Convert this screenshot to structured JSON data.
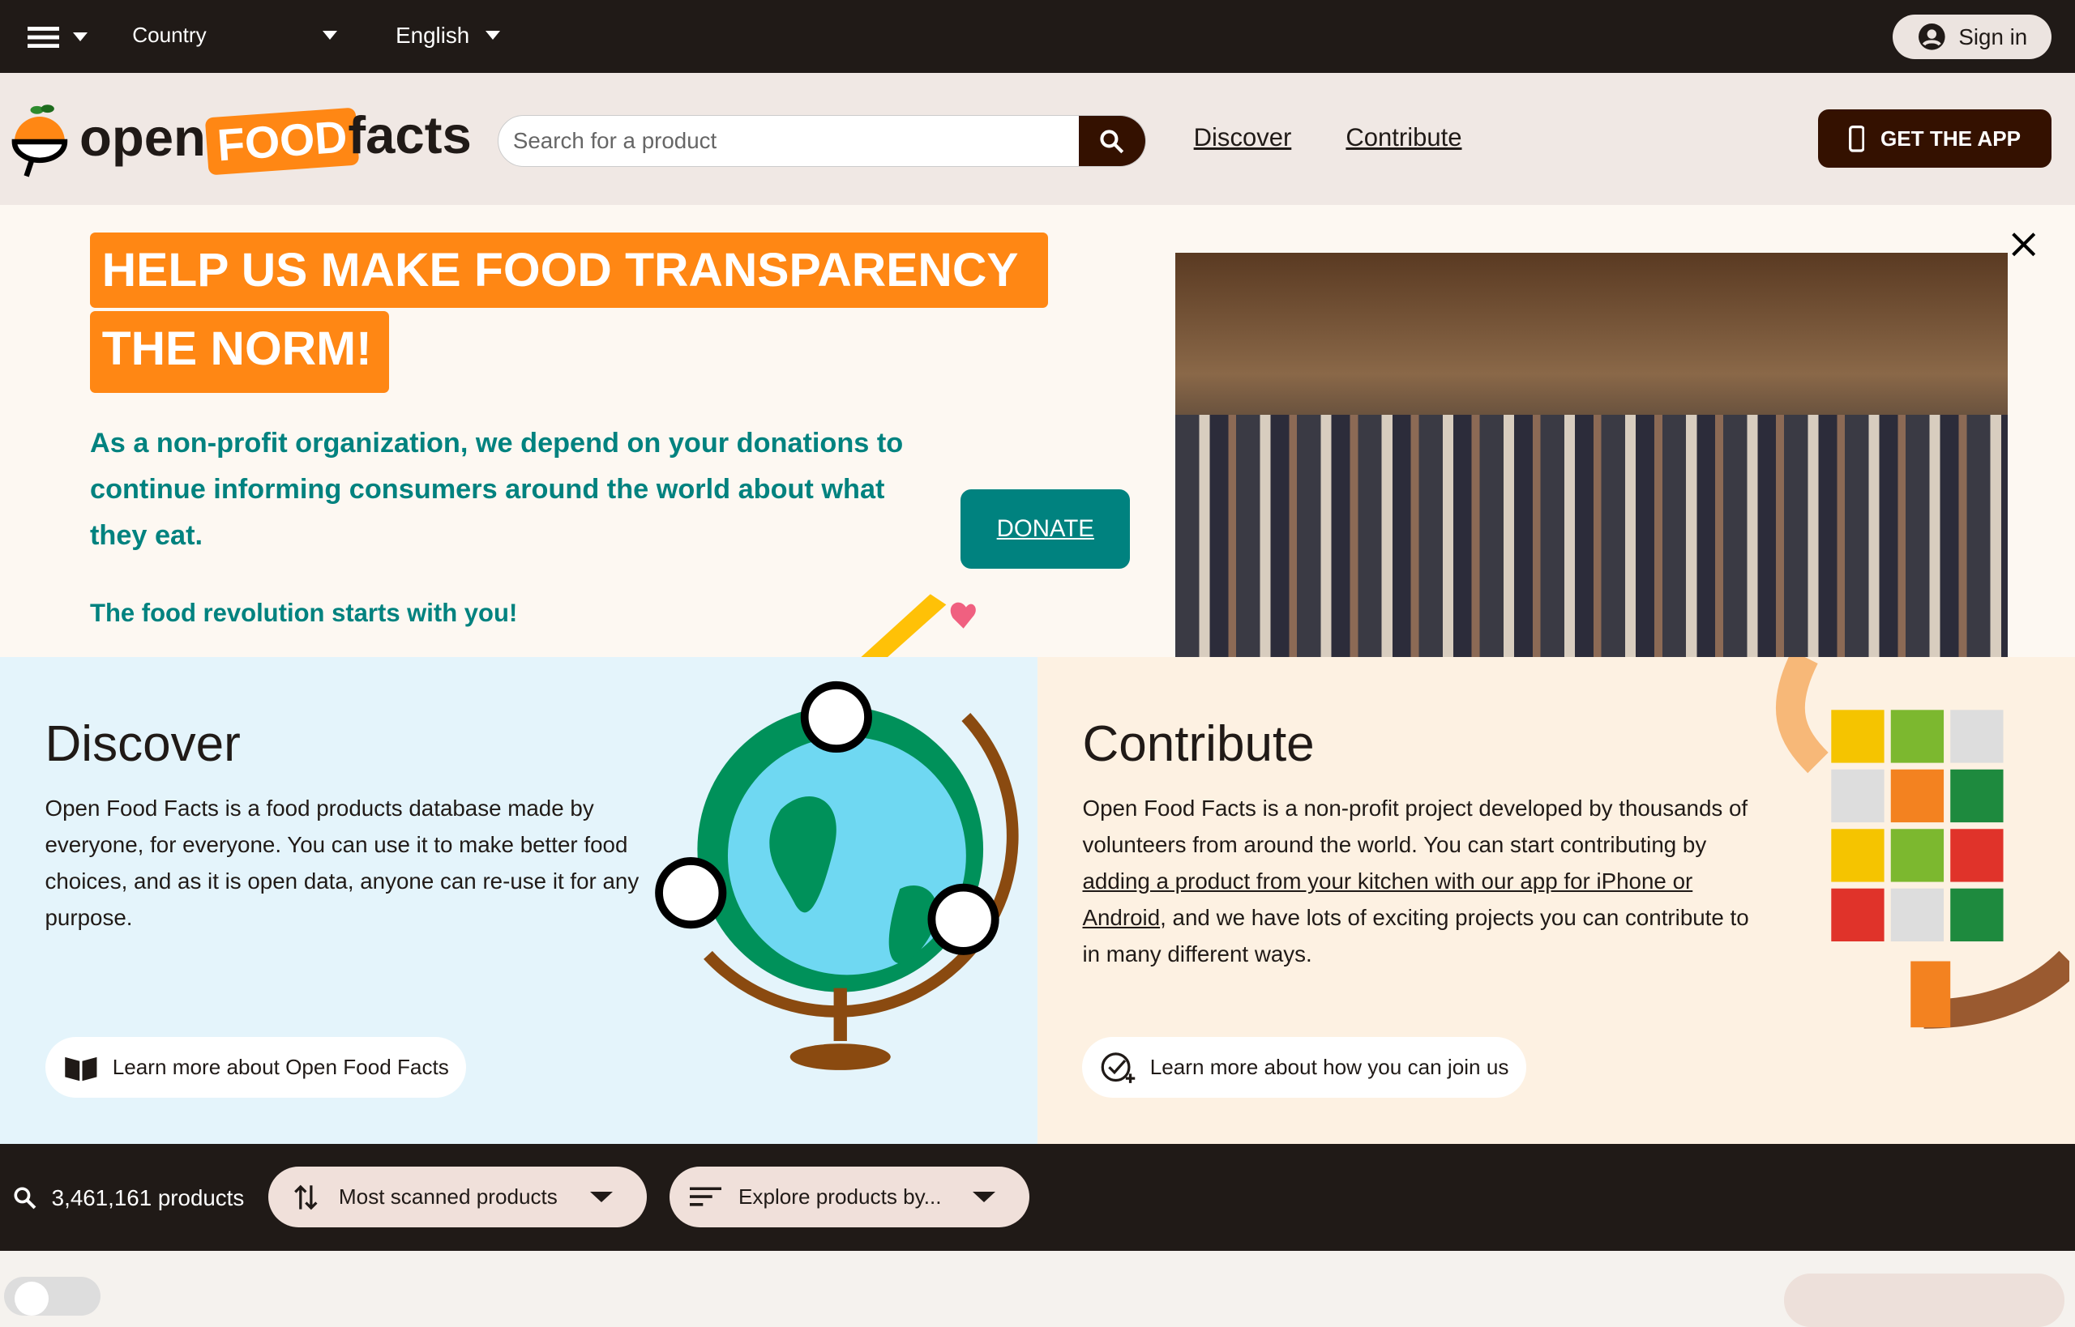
{
  "topbar": {
    "country": "Country",
    "language": "English",
    "signin": "Sign in"
  },
  "header": {
    "logo": {
      "open": "open",
      "food": "FOOD",
      "facts": "facts"
    },
    "search_placeholder": "Search for a product",
    "nav": [
      "Discover",
      "Contribute"
    ],
    "get_app": "GET THE APP"
  },
  "banner": {
    "headline_1": "HELP US MAKE FOOD TRANSPARENCY",
    "headline_2": "THE NORM!",
    "subtitle_lines": [
      "As a non-profit organization, we depend on your donations to",
      "continue informing consumers around the world about what",
      "they eat."
    ],
    "tagline": "The food revolution starts with you!",
    "donate": "DONATE"
  },
  "discover": {
    "title": "Discover",
    "text": "Open Food Facts is a food products database made by everyone, for everyone. You can use it to make better food choices, and as it is open data, anyone can re-use it for any purpose.",
    "button": "Learn more about Open Food Facts"
  },
  "contribute": {
    "title": "Contribute",
    "text_before": "Open Food Facts is a non-profit project developed by thousands of volunteers from around the world. You can start contributing by ",
    "link": "adding a product from your kitchen with our app for iPhone or Android",
    "text_after": ", and we have lots of exciting projects you can contribute to in many different ways.",
    "button": "Learn more about how you can join us"
  },
  "products": {
    "count": "3,461,161 products",
    "sort": "Most scanned products",
    "explore": "Explore products by..."
  },
  "colors": {
    "dark": "#201a17",
    "orange": "#ff8714",
    "teal": "#00827f",
    "brown": "#341100"
  }
}
